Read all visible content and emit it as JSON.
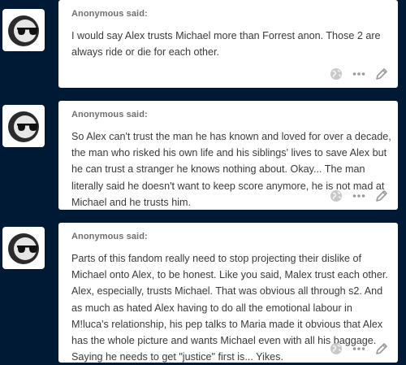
{
  "posts": [
    {
      "asker": "Anonymous said:",
      "text": "I would say Alex trusts Michael more than Forrest anon. Those 2 are always ride or die for each other."
    },
    {
      "asker": "Anonymous said:",
      "text": "So Alex can't trust the man he has known and loved for over a decade, the man who risked his own life and his siblings' lives to save Alex but he can trust a stranger he knows nothing about. Okay... The man literally said he doesn't want to keep score anymore, he is not mad at Michael and he trusts him."
    },
    {
      "asker": "Anonymous said:",
      "text": "Parts of this fandom really need to stop projecting their dislike of Michael onto Alex, to be honest. Like you said, Malex trust each other. Alex, especially, trusts Michael. That was obvious all through s2. And as much as hated Alex having to do all the emotional labour in M!luca's relationship, his pep talks to Maria made it obvious that Alex has the whole picture and wants Michael even with all his baggage. Saying he needs to get \"justice\" first is... Yikes."
    }
  ],
  "icons": {
    "avatar": "sunglasses-avatar-icon",
    "globe": "globe-icon",
    "more": "more-dots-icon",
    "edit": "pencil-icon"
  },
  "colors": {
    "background": "#001935",
    "card": "#ffffff",
    "text": "#3a3a3a",
    "asker": "#6f6f6f",
    "icon": "#999999"
  }
}
